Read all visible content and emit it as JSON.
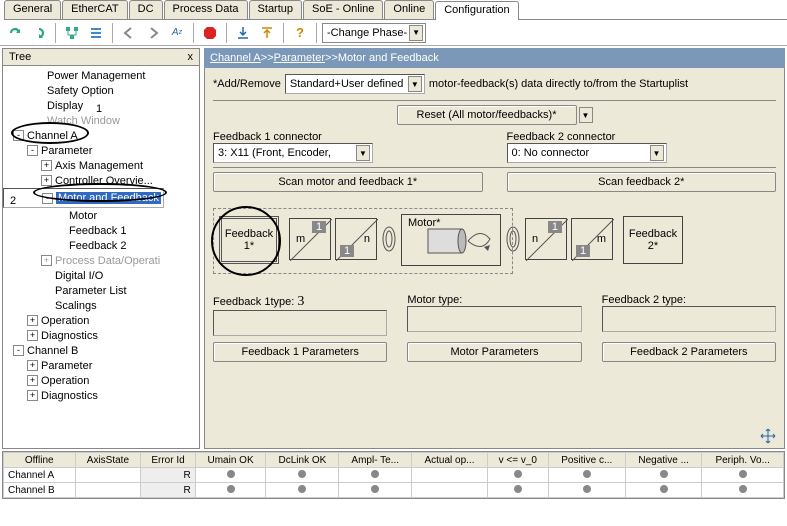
{
  "tabs": [
    "General",
    "EtherCAT",
    "DC",
    "Process Data",
    "Startup",
    "SoE - Online",
    "Online",
    "Configuration"
  ],
  "active_tab": 7,
  "toolbar": {
    "phase_label": "-Change Phase-"
  },
  "tree": {
    "title": "Tree",
    "close": "x",
    "items": [
      {
        "pad": 30,
        "exp": null,
        "label": "Power Management"
      },
      {
        "pad": 30,
        "exp": null,
        "label": "Safety Option"
      },
      {
        "pad": 30,
        "exp": null,
        "label": "Display"
      },
      {
        "pad": 30,
        "exp": null,
        "label": "Watch Window",
        "dim": true
      },
      {
        "pad": 10,
        "exp": "-",
        "label": "Channel A"
      },
      {
        "pad": 24,
        "exp": "-",
        "label": "Parameter"
      },
      {
        "pad": 38,
        "exp": "+",
        "label": "Axis Management"
      },
      {
        "pad": 38,
        "exp": "+",
        "label": "Controller Overvie..."
      },
      {
        "pad": 38,
        "exp": "-",
        "label": "Motor and Feedback",
        "sel": true
      },
      {
        "pad": 52,
        "exp": null,
        "label": "Motor"
      },
      {
        "pad": 52,
        "exp": null,
        "label": "Feedback 1"
      },
      {
        "pad": 52,
        "exp": null,
        "label": "Feedback 2"
      },
      {
        "pad": 38,
        "exp": "+",
        "label": "Process Data/Operati",
        "dim": true
      },
      {
        "pad": 38,
        "exp": null,
        "label": "Digital I/O"
      },
      {
        "pad": 38,
        "exp": null,
        "label": "Parameter List"
      },
      {
        "pad": 38,
        "exp": null,
        "label": "Scalings"
      },
      {
        "pad": 24,
        "exp": "+",
        "label": "Operation"
      },
      {
        "pad": 24,
        "exp": "+",
        "label": "Diagnostics"
      },
      {
        "pad": 10,
        "exp": "-",
        "label": "Channel B"
      },
      {
        "pad": 24,
        "exp": "+",
        "label": "Parameter"
      },
      {
        "pad": 24,
        "exp": "+",
        "label": "Operation"
      },
      {
        "pad": 24,
        "exp": "+",
        "label": "Diagnostics"
      }
    ]
  },
  "breadcrumb": {
    "a": "Channel A",
    "b": "Parameter",
    "c": "Motor and Feedback"
  },
  "panel": {
    "addremove_pre": "*Add/Remove",
    "addremove_sel": "Standard+User defined",
    "addremove_post": "motor-feedback(s) data directly to/from the Startuplist",
    "reset": "Reset (All motor/feedbacks)*",
    "fb1_conn_label": "Feedback 1 connector",
    "fb1_conn_val": "3: X11 (Front, Encoder,",
    "fb2_conn_label": "Feedback 2 connector",
    "fb2_conn_val": "0: No connector",
    "scan1": "Scan motor and feedback 1*",
    "scan2": "Scan feedback 2*",
    "fb1_box": "Feedback 1*",
    "motor_box": "Motor*",
    "fb2_box": "Feedback 2*",
    "ratio_m": "m",
    "ratio_n": "n",
    "ratio_1": "1",
    "fb1_type": "Feedback 1type:",
    "motor_type": "Motor type:",
    "fb2_type": "Feedback 2 type:",
    "btn_fb1": "Feedback 1 Parameters",
    "btn_motor": "Motor Parameters",
    "btn_fb2": "Feedback 2 Parameters"
  },
  "status": {
    "cols": [
      "Offline",
      "AxisState",
      "Error Id",
      "Umain OK",
      "DcLink OK",
      "Ampl- Te...",
      "Actual op...",
      "v <= v_0",
      "Positive c...",
      "Negative ...",
      "Periph. Vo..."
    ],
    "rows": [
      {
        "label": "Channel A",
        "err": "R",
        "dots": [
          1,
          1,
          1,
          0,
          1,
          1,
          1,
          1
        ]
      },
      {
        "label": "Channel B",
        "err": "R",
        "dots": [
          1,
          1,
          1,
          0,
          1,
          1,
          1,
          1
        ]
      }
    ]
  },
  "annotations": {
    "n1": "1",
    "n2": "2",
    "n3": "3"
  }
}
